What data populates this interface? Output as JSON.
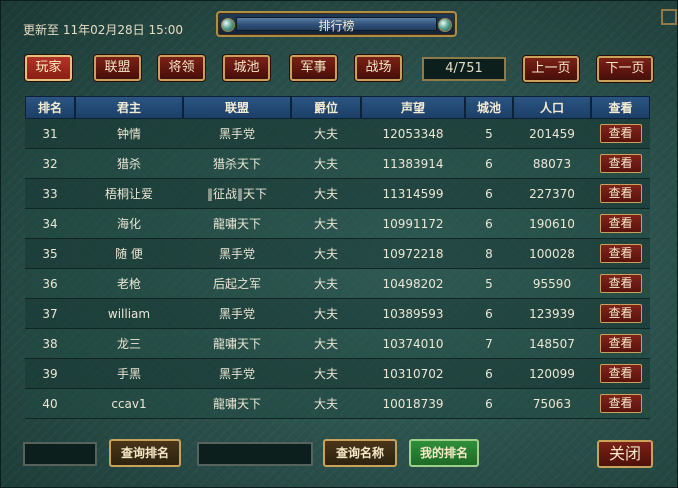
{
  "update_text": "更新至  11年02月28日 15:00",
  "window_title": "排行榜",
  "tabs": [
    {
      "label": "玩家",
      "active": true
    },
    {
      "label": "联盟",
      "active": false
    },
    {
      "label": "将领",
      "active": false
    },
    {
      "label": "城池",
      "active": false
    },
    {
      "label": "军事",
      "active": false
    },
    {
      "label": "战场",
      "active": false
    }
  ],
  "page_info": "4/751",
  "prev_label": "上一页",
  "next_label": "下一页",
  "columns": [
    "排名",
    "君主",
    "联盟",
    "爵位",
    "声望",
    "城池",
    "人口",
    "查看"
  ],
  "rows": [
    {
      "rank": "31",
      "lord": "钟情",
      "alliance": "黑手党",
      "title": "大夫",
      "prestige": "12053348",
      "cities": "5",
      "population": "201459",
      "view": "查看"
    },
    {
      "rank": "32",
      "lord": "猎杀",
      "alliance": "猎杀天下",
      "title": "大夫",
      "prestige": "11383914",
      "cities": "6",
      "population": "88073",
      "view": "查看"
    },
    {
      "rank": "33",
      "lord": "梧桐让爱",
      "alliance": "‖征战‖天下",
      "title": "大夫",
      "prestige": "11314599",
      "cities": "6",
      "population": "227370",
      "view": "查看"
    },
    {
      "rank": "34",
      "lord": "海化",
      "alliance": "龍嘯天下",
      "title": "大夫",
      "prestige": "10991172",
      "cities": "6",
      "population": "190610",
      "view": "查看"
    },
    {
      "rank": "35",
      "lord": "随 便",
      "alliance": "黑手党",
      "title": "大夫",
      "prestige": "10972218",
      "cities": "8",
      "population": "100028",
      "view": "查看"
    },
    {
      "rank": "36",
      "lord": "老枪",
      "alliance": "后起之军",
      "title": "大夫",
      "prestige": "10498202",
      "cities": "5",
      "population": "95590",
      "view": "查看"
    },
    {
      "rank": "37",
      "lord": "william",
      "alliance": "黑手党",
      "title": "大夫",
      "prestige": "10389593",
      "cities": "6",
      "population": "123939",
      "view": "查看"
    },
    {
      "rank": "38",
      "lord": "龙三",
      "alliance": "龍嘯天下",
      "title": "大夫",
      "prestige": "10374010",
      "cities": "7",
      "population": "148507",
      "view": "查看"
    },
    {
      "rank": "39",
      "lord": "手黑",
      "alliance": "黑手党",
      "title": "大夫",
      "prestige": "10310702",
      "cities": "6",
      "population": "120099",
      "view": "查看"
    },
    {
      "rank": "40",
      "lord": "ccav1",
      "alliance": "龍嘯天下",
      "title": "大夫",
      "prestige": "10018739",
      "cities": "6",
      "population": "75063",
      "view": "查看"
    }
  ],
  "query_rank_label": "查询排名",
  "query_name_label": "查询名称",
  "my_rank_label": "我的排名",
  "close_label": "关闭",
  "colors": {
    "accent_gold": "#c8a25a",
    "button_red": "#7a2218",
    "header_blue": "#2b5583",
    "green_button": "#2f8f3a"
  }
}
